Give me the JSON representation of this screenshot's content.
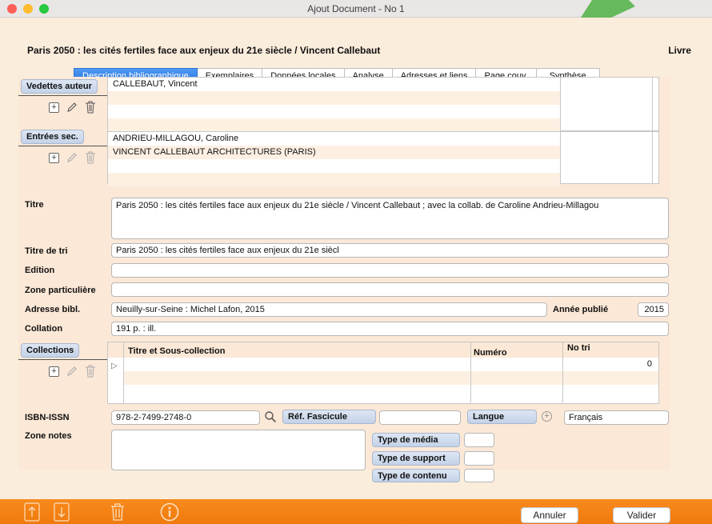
{
  "window": {
    "title": "Ajout Document - No 1"
  },
  "header": {
    "doc_title": "Paris 2050 : les cités fertiles face aux enjeux du 21e siècle / Vincent Callebaut",
    "doc_type": "Livre"
  },
  "tabs": [
    {
      "label": "Description bibliographique",
      "active": true
    },
    {
      "label": "Exemplaires"
    },
    {
      "label": "Données locales"
    },
    {
      "label": "Analyse"
    },
    {
      "label": "Adresses et liens"
    },
    {
      "label": "Page couv."
    },
    {
      "label": "Synthèse"
    }
  ],
  "form": {
    "vedettes_auteur": {
      "label": "Vedettes auteur",
      "rows": [
        "CALLEBAUT, Vincent",
        "",
        "",
        ""
      ]
    },
    "entrees_sec": {
      "label": "Entrées sec.",
      "rows": [
        "ANDRIEU-MILLAGOU, Caroline",
        "VINCENT CALLEBAUT ARCHITECTURES (PARIS)",
        "",
        ""
      ]
    },
    "titre": {
      "label": "Titre",
      "value": "Paris 2050 : les cités fertiles face aux enjeux du 21e siècle / Vincent Callebaut ; avec la collab. de Caroline Andrieu-Millagou"
    },
    "titre_de_tri": {
      "label": "Titre de tri",
      "value": "Paris 2050 : les cités fertiles face aux enjeux du 21e siècl"
    },
    "edition": {
      "label": "Edition",
      "value": ""
    },
    "zone_particuliere": {
      "label": "Zone particulière",
      "value": ""
    },
    "adresse_bibl": {
      "label": "Adresse bibl.",
      "value": "Neuilly-sur-Seine : Michel Lafon, 2015"
    },
    "annee_publie": {
      "label": "Année publié",
      "value": "2015"
    },
    "collation": {
      "label": "Collation",
      "value": "191 p. : ill."
    },
    "collections": {
      "label": "Collections",
      "headers": {
        "titre": "Titre et Sous-collection",
        "numero": "Numéro",
        "no_tri": "No tri"
      },
      "first_row_no_tri": "0"
    },
    "isbn_issn": {
      "label": "ISBN-ISSN",
      "value": "978-2-7499-2748-0"
    },
    "ref_fascicule": {
      "label": "Réf. Fascicule",
      "value": ""
    },
    "langue": {
      "label": "Langue",
      "value": "Français"
    },
    "zone_notes": {
      "label": "Zone notes",
      "value": ""
    },
    "type_de_media": {
      "label": "Type de média",
      "value": ""
    },
    "type_de_support": {
      "label": "Type de support",
      "value": ""
    },
    "type_de_contenu": {
      "label": "Type de contenu",
      "value": ""
    }
  },
  "footer": {
    "cancel": "Annuler",
    "validate": "Valider"
  },
  "colors": {
    "accent": "#f6851a",
    "tab_active": "#2f7be6",
    "panel_bg": "#fbe8d6"
  }
}
